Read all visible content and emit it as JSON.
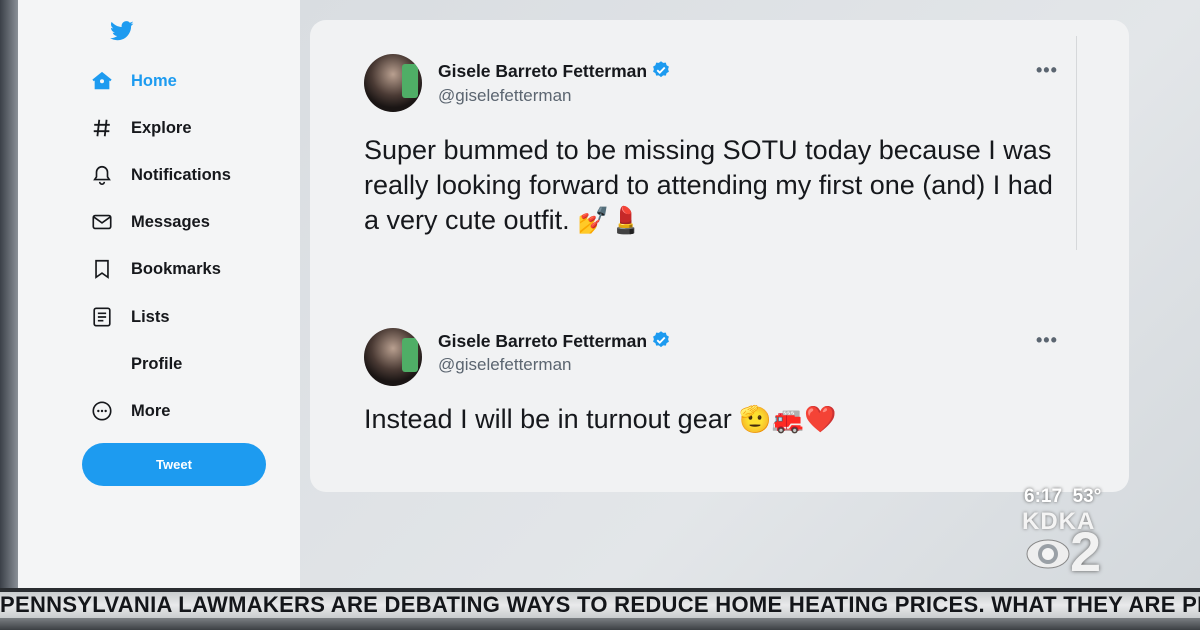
{
  "sidebar": {
    "logo_icon": "twitter-bird-icon",
    "items": [
      {
        "label": "Home",
        "icon": "home-icon",
        "active": true
      },
      {
        "label": "Explore",
        "icon": "hashtag-icon"
      },
      {
        "label": "Notifications",
        "icon": "bell-icon"
      },
      {
        "label": "Messages",
        "icon": "envelope-icon"
      },
      {
        "label": "Bookmarks",
        "icon": "bookmark-icon"
      },
      {
        "label": "Lists",
        "icon": "list-icon"
      },
      {
        "label": "Profile",
        "icon": ""
      },
      {
        "label": "More",
        "icon": "more-circle-icon"
      }
    ],
    "tweet_button": "Tweet"
  },
  "tweets": [
    {
      "name": "Gisele Barreto Fetterman",
      "handle": "@giselefetterman",
      "verified": true,
      "text": "Super bummed to be missing SOTU today because I was really looking forward to attending my first one (and) I had a very cute outfit.",
      "emoji": "💅💄",
      "more": "•••"
    },
    {
      "name": "Gisele Barreto Fetterman",
      "handle": "@giselefetterman",
      "verified": true,
      "text": "Instead I will be in turnout gear",
      "emoji": "🫡🚒❤️",
      "more": "•••"
    }
  ],
  "station": {
    "time": "6:17",
    "temp": "53°",
    "callsign": "KDKA",
    "channel": "2"
  },
  "ticker": {
    "text": "PENNSYLVANIA LAWMAKERS ARE DEBATING WAYS TO REDUCE HOME HEATING PRICES.  WHAT THEY ARE PR"
  },
  "colors": {
    "accent": "#1d9bf0",
    "text": "#16181c",
    "muted": "#5b6570"
  }
}
